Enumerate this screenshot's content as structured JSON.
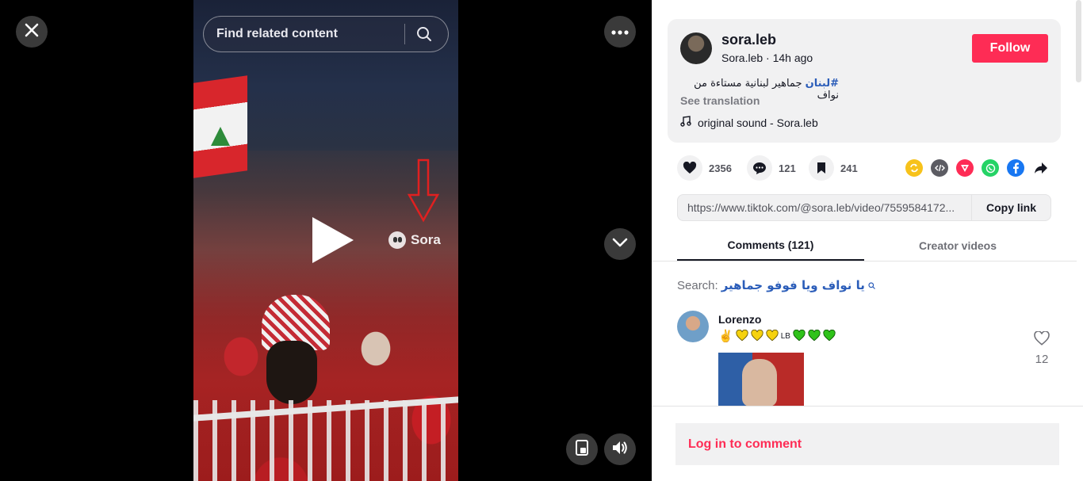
{
  "video": {
    "search_placeholder": "Find related content",
    "watermark": "Sora"
  },
  "post": {
    "username": "sora.leb",
    "display_name": "Sora.leb",
    "separator": " · ",
    "time_ago": "14h ago",
    "follow_label": "Follow",
    "caption_tag": "#لبنان",
    "caption_text": "جماهير لبنانية مستاءة من نواف",
    "see_translation": "See translation",
    "sound": "original sound - Sora.leb"
  },
  "actions": {
    "likes": "2356",
    "comments": "121",
    "saves": "241"
  },
  "share": {
    "icons": [
      "repost-icon",
      "embed-icon",
      "send-icon",
      "whatsapp-icon",
      "facebook-icon",
      "share-arrow-icon"
    ],
    "colors": {
      "repost": "#f7c21b",
      "embed": "#5c5c63",
      "send": "#fe2c55",
      "whatsapp": "#25d366",
      "facebook": "#1877f2"
    }
  },
  "link": {
    "url": "https://www.tiktok.com/@sora.leb/video/7559584172...",
    "copy_label": "Copy link"
  },
  "tabs": [
    {
      "label": "Comments (121)"
    },
    {
      "label": "Creator videos"
    }
  ],
  "comment_search": {
    "prefix": "Search:",
    "query": "يا نواف ويا فوفو جماهير"
  },
  "comments": [
    {
      "name": "Lorenzo",
      "emoji_text": "✌️",
      "flag_text": "LB",
      "likes": "12"
    }
  ],
  "login_comment": "Log in to comment",
  "colors": {
    "accent": "#fe2c55",
    "link_blue": "#2b5db9"
  }
}
